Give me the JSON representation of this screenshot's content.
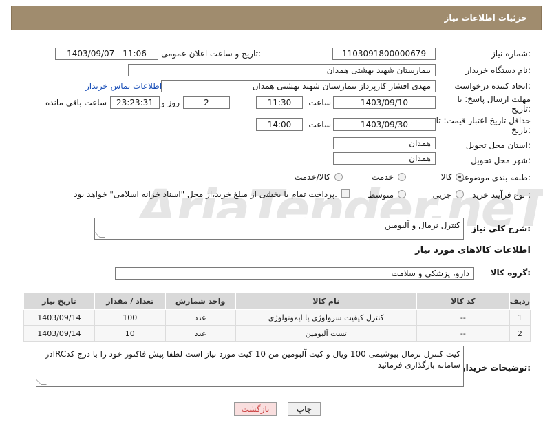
{
  "header": {
    "title": "جزئیات اطلاعات نیاز"
  },
  "fields": {
    "need_number_label": "شماره نیاز:",
    "need_number": "1103091800000679",
    "announce_label": "تاریخ و ساعت اعلان عمومی:",
    "announce_value": "1403/09/07 - 11:06",
    "buyer_org_label": "نام دستگاه خریدار:",
    "buyer_org": "بیمارستان شهید بهشتی همدان",
    "requester_label": "ایجاد کننده درخواست:",
    "requester": "مهدی افشار کارپرداز بیمارستان شهید بهشتی همدان",
    "buyer_contact_link": "اطلاعات تماس خریدار",
    "deadline_label_1": "مهلت ارسال پاسخ: تا",
    "deadline_label_2": "تاریخ:",
    "deadline_date": "1403/09/10",
    "time_label": "ساعت",
    "deadline_time": "11:30",
    "days_value": "2",
    "days_label": "روز و",
    "remaining_time": "23:23:31",
    "remaining_label": "ساعت باقی مانده",
    "validity_label_1": "حداقل تاریخ اعتبار قیمت: تا",
    "validity_label_2": "تاریخ:",
    "validity_date": "1403/09/30",
    "validity_time_label": "ساعت",
    "validity_time": "14:00",
    "province_label": "استان محل تحویل:",
    "province": "همدان",
    "city_label": "شهر محل تحویل:",
    "city": "همدان",
    "category_label": "طبقه بندی موضوعی:",
    "category_options": [
      "کالا",
      "خدمت",
      "کالا/خدمت"
    ],
    "process_label": "نوع فرآیند خرید :",
    "process_options": [
      "جزیی",
      "متوسط"
    ],
    "treasury_note": "پرداخت تمام یا بخشی از مبلغ خرید،از محل \"اسناد خزانه اسلامی\" خواهد بود.",
    "summary_label": "شرح کلی نیاز:",
    "summary": "کنترل نرمال و آلبومین",
    "goods_info_title": "اطلاعات کالاهای مورد نیاز",
    "goods_group_label": "گروه کالا:",
    "goods_group": "دارو، پزشکی و سلامت",
    "buyer_notes_label": "توضیحات خریدار:",
    "buyer_notes": "کیت کنترل نرمال بیوشیمی 100 ویال و کیت آلبومین من 10 کیت مورد نیاز است لطفا پیش فاکتور خود را با درج کدIRCدر سامانه بارگذاری فرمائید"
  },
  "table": {
    "headers": [
      "ردیف",
      "کد کالا",
      "نام کالا",
      "واحد شمارش",
      "تعداد / مقدار",
      "تاریخ نیاز"
    ],
    "rows": [
      [
        "1",
        "--",
        "کنترل کیفیت سرولوژی یا ایمونولوژی",
        "عدد",
        "100",
        "1403/09/14"
      ],
      [
        "2",
        "--",
        "تست آلبومین",
        "عدد",
        "10",
        "1403/09/14"
      ]
    ]
  },
  "buttons": {
    "print": "چاپ",
    "back": "بازگشت"
  },
  "watermark": "AriaTender.neT"
}
